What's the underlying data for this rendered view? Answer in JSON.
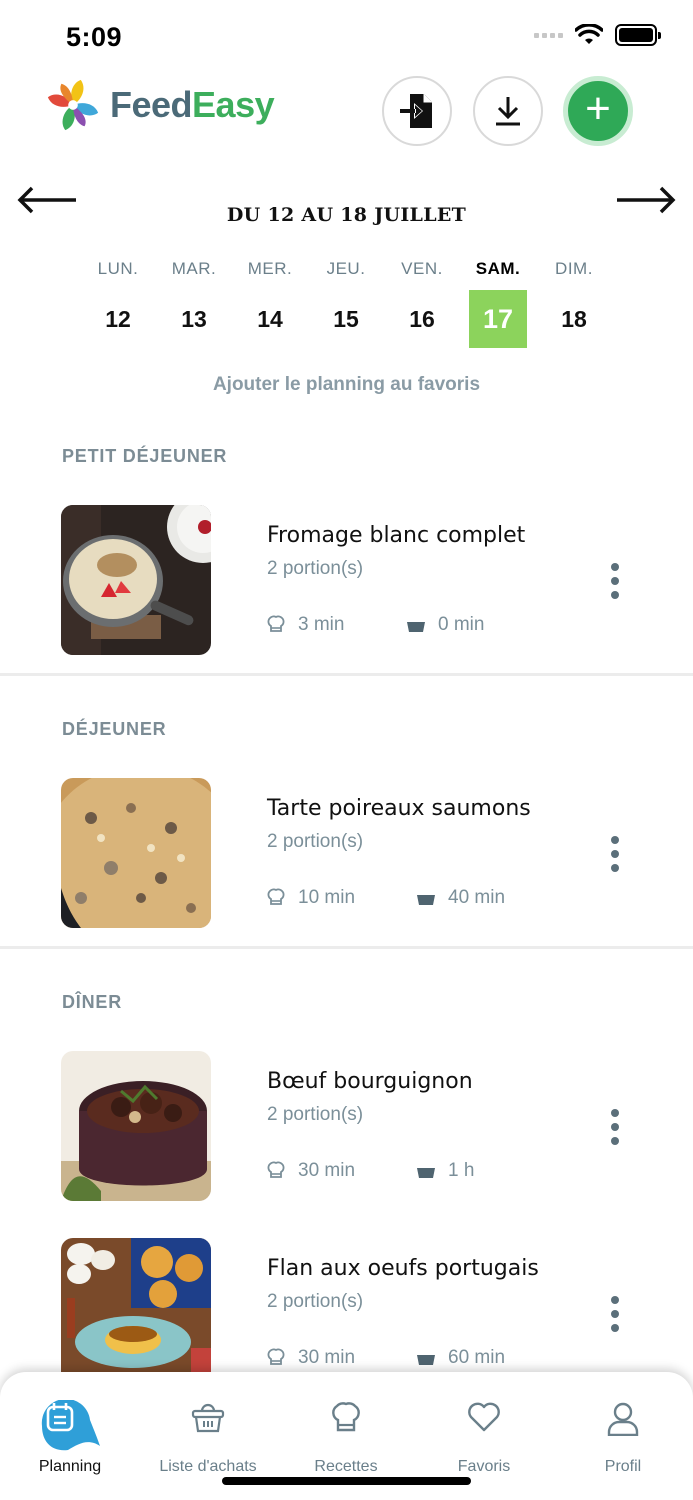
{
  "status_bar": {
    "time": "5:09"
  },
  "header": {
    "logo_feed": "Feed",
    "logo_easy": "Easy",
    "brand_color": "#3dae5c"
  },
  "week": {
    "range": "DU 12 AU 18 JUILLET",
    "days": [
      {
        "name": "LUN.",
        "num": "12"
      },
      {
        "name": "MAR.",
        "num": "13"
      },
      {
        "name": "MER.",
        "num": "14"
      },
      {
        "name": "JEU.",
        "num": "15"
      },
      {
        "name": "VEN.",
        "num": "16"
      },
      {
        "name": "SAM.",
        "num": "17"
      },
      {
        "name": "DIM.",
        "num": "18"
      }
    ],
    "selected_day": "17",
    "selected_color": "#8cd35c"
  },
  "favorite_link": "Ajouter le planning au favoris",
  "sections": {
    "breakfast": {
      "title": "PETIT DÉJEUNER",
      "meals": [
        {
          "name": "Fromage blanc complet",
          "portions": "2 portion(s)",
          "prep": "3 min",
          "cook": "0 min"
        }
      ]
    },
    "lunch": {
      "title": "DÉJEUNER",
      "meals": [
        {
          "name": "Tarte poireaux saumons",
          "portions": "2 portion(s)",
          "prep": "10 min",
          "cook": "40 min"
        }
      ]
    },
    "dinner": {
      "title": "DÎNER",
      "meals": [
        {
          "name": "Bœuf bourguignon",
          "portions": "2 portion(s)",
          "prep": "30 min",
          "cook": "1 h"
        },
        {
          "name": "Flan aux oeufs portugais",
          "portions": "2 portion(s)",
          "prep": "30 min",
          "cook": "60 min"
        }
      ]
    }
  },
  "tabbar": {
    "planning": "Planning",
    "shopping": "Liste d'achats",
    "recipes": "Recettes",
    "favorites": "Favoris",
    "profile": "Profil",
    "active_color": "#2f9fd8"
  }
}
